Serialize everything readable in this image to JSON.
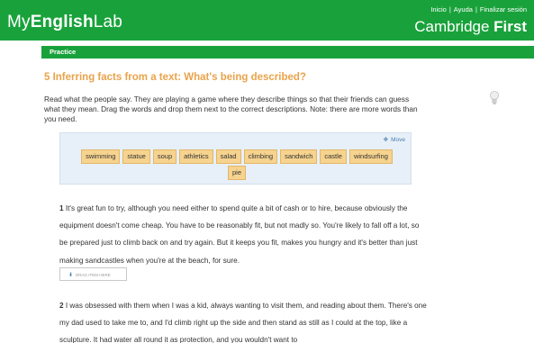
{
  "header": {
    "brand": {
      "my": "My",
      "english": "English",
      "lab": "Lab"
    },
    "links": [
      "Inicio",
      "Ayuda",
      "Finalizar sesión"
    ],
    "separator": "|",
    "course": {
      "part1": "Cambridge ",
      "part2": "First"
    }
  },
  "tabbar": {
    "label": "Practice"
  },
  "exercise": {
    "title": "5 Inferring facts from a text: What's being described?",
    "instructions": "Read what the people say. They are playing a game where they describe things so that their friends can guess what they mean. Drag the words and drop them next to the correct descriptions. Note: there are more words than you need."
  },
  "wordbank": {
    "move_label": "Move",
    "words": [
      "swimming",
      "statue",
      "soup",
      "athletics",
      "salad",
      "climbing",
      "sandwich",
      "castle",
      "windsurfing",
      "pie"
    ]
  },
  "questions": [
    {
      "number": "1",
      "text": "It's great fun to try, although you need either to spend quite a bit of cash or to hire, because obviously the equipment doesn't come cheap. You have to be reasonably fit, but not madly so. You're likely to fall off a lot, so be prepared just to climb back on and try again. But it keeps you fit, makes you hungry and it's better than just making sandcastles when you're at the beach, for sure.",
      "drop_label": "DRAG ITEM HERE"
    },
    {
      "number": "2",
      "text": "I was obsessed with them when I was a kid, always wanting to visit them, and reading about them. There's one my dad used to take me to, and I'd climb right up the side and then stand as still as I could at the top, like a sculpture. It had water all round it as protection, and you wouldn't want to"
    }
  ],
  "colors": {
    "brand_green": "#19a23b",
    "title_orange": "#e9a34b",
    "chip_fill": "#f6d38e",
    "bank_bg": "#e7f0f8"
  },
  "icons": {
    "move": "move-icon",
    "bulb": "lightbulb-icon",
    "drop": "download-icon"
  }
}
